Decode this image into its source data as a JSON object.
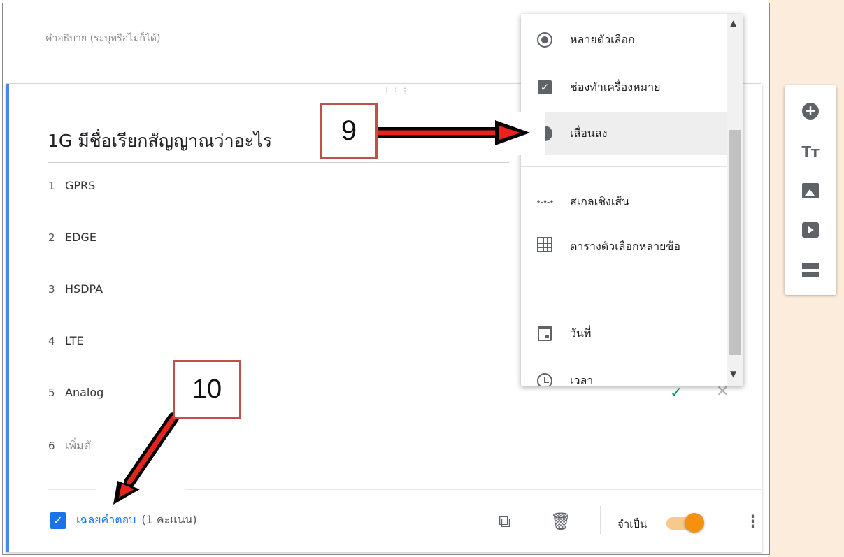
{
  "description_placeholder": "คำอธิบาย (ระบุหรือไม่ก็ได้)",
  "question": {
    "title": "1G มีชื่อเรียกสัญญาณว่าอะไร",
    "options": [
      {
        "number": "1",
        "label": "GPRS"
      },
      {
        "number": "2",
        "label": "EDGE"
      },
      {
        "number": "3",
        "label": "HSDPA"
      },
      {
        "number": "4",
        "label": "LTE"
      },
      {
        "number": "5",
        "label": "Analog"
      },
      {
        "number": "6",
        "label": "เพิ่มตั"
      }
    ]
  },
  "footer": {
    "answer_key_link": "เฉลยคำตอบ",
    "points": "(1 คะแนน)",
    "required_label": "จำเป็น",
    "required_on": true
  },
  "menu": {
    "items": [
      {
        "label": "หลายตัวเลือก",
        "icon": "radio-icon"
      },
      {
        "label": "ช่องทำเครื่องหมาย",
        "icon": "checkbox-icon"
      },
      {
        "label": "เลื่อนลง",
        "icon": "dropdown-icon",
        "selected": true
      },
      {
        "label": "สเกลเชิงเส้น",
        "icon": "linear-scale-icon"
      },
      {
        "label": "ตารางตัวเลือกหลายข้อ",
        "icon": "grid-icon"
      },
      {
        "label": "วันที่",
        "icon": "calendar-icon"
      },
      {
        "label": "เวลา",
        "icon": "clock-icon"
      }
    ]
  },
  "toolbar": {
    "tt_label": "Tт"
  },
  "callouts": {
    "step9": "9",
    "step10": "10"
  },
  "colors": {
    "accent": "#4a86e8",
    "toggle": "#f4910d",
    "callout_border": "#c0504d",
    "arrow": "#e8231e"
  }
}
